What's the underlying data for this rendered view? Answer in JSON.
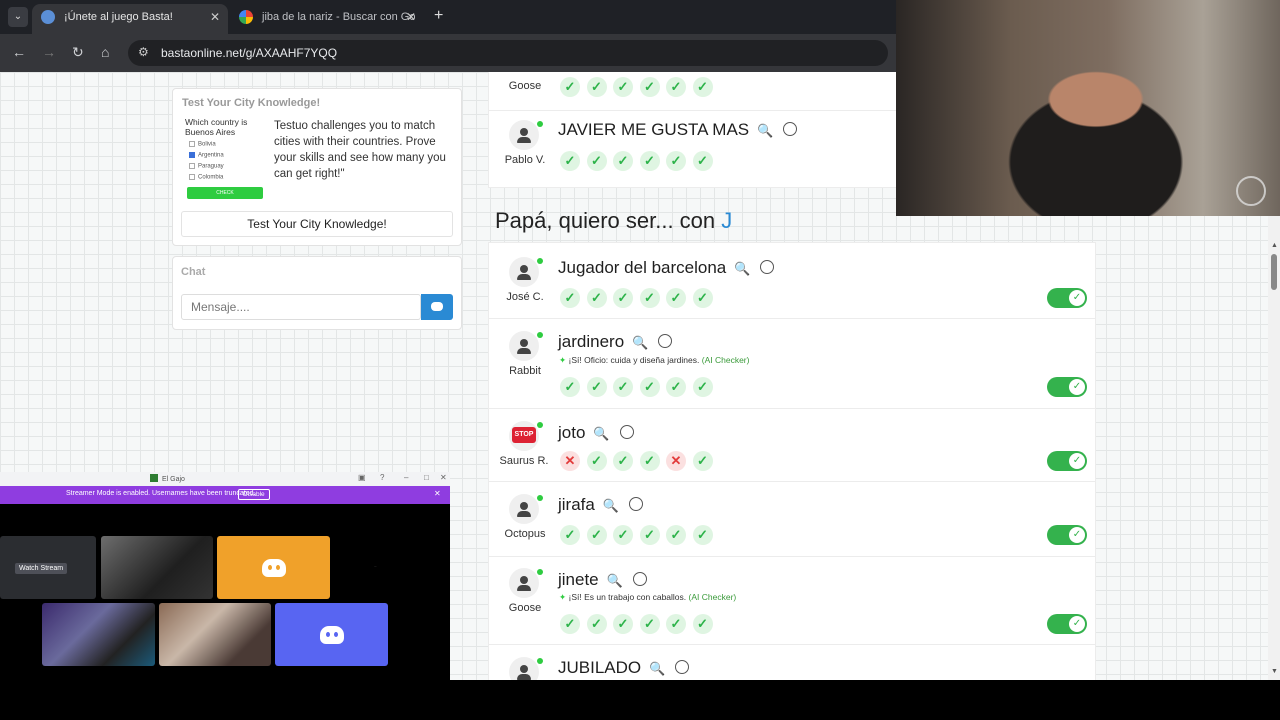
{
  "browser": {
    "tabs": [
      {
        "title": "¡Únete al juego Basta!",
        "close": "✕"
      },
      {
        "title": "jiba de la nariz - Buscar con Go",
        "close": "✕"
      }
    ],
    "new_tab": "+",
    "tab_menu": "⌄",
    "url": "bastaonline.net/g/AXAAHF7YQQ",
    "nav": {
      "back": "←",
      "forward": "→",
      "reload": "↻",
      "home": "⌂",
      "site_info": "⚙"
    }
  },
  "promo": {
    "title": "Test Your City Knowledge!",
    "quiz_question": "Which country is Buenos Aires",
    "quiz_options": [
      "Bolivia",
      "Argentina",
      "Paraguay",
      "Colombia"
    ],
    "quiz_selected": "Argentina",
    "quiz_button": "CHECK",
    "blurb": "Testuo challenges you to match cities with their countries. Prove your skills and see how many you can get right!\"",
    "button": "Test Your City Knowledge!"
  },
  "chat": {
    "title": "Chat",
    "placeholder": "Mensaje...."
  },
  "previous_category": {
    "partial_row": {
      "user": "Goose",
      "votes": [
        "ok",
        "ok",
        "ok",
        "ok",
        "ok",
        "ok"
      ]
    },
    "row": {
      "user": "Pablo V.",
      "word": "JAVIER ME GUSTA MAS",
      "votes": [
        "ok",
        "ok",
        "ok",
        "ok",
        "ok",
        "ok"
      ]
    }
  },
  "category": {
    "prefix": "Papá, quiero ser... con",
    "letter": "J"
  },
  "answers": [
    {
      "user": "José C.",
      "word": "Jugador del barcelona",
      "ai_note": null,
      "votes": [
        "ok",
        "ok",
        "ok",
        "ok",
        "ok",
        "ok"
      ],
      "accepted": true
    },
    {
      "user": "Rabbit",
      "word": "jardinero",
      "ai_note": {
        "text": "¡Sí! Oficio: cuida y diseña jardines.",
        "tag": "(AI Checker)"
      },
      "votes": [
        "ok",
        "ok",
        "ok",
        "ok",
        "ok",
        "ok"
      ],
      "accepted": true
    },
    {
      "user": "Saurus R.",
      "word": "joto",
      "ai_note": null,
      "votes": [
        "no",
        "ok",
        "ok",
        "ok",
        "no",
        "ok"
      ],
      "accepted": true,
      "avatar_text": "STOP"
    },
    {
      "user": "Octopus",
      "word": "jirafa",
      "ai_note": null,
      "votes": [
        "ok",
        "ok",
        "ok",
        "ok",
        "ok",
        "ok"
      ],
      "accepted": true
    },
    {
      "user": "Goose",
      "word": "jinete",
      "ai_note": {
        "text": "¡Sí! Es un trabajo con caballos.",
        "tag": "(AI Checker)"
      },
      "votes": [
        "ok",
        "ok",
        "ok",
        "ok",
        "ok",
        "ok"
      ],
      "accepted": true
    },
    {
      "user": "",
      "word": "JUBILADO",
      "ai_note": null,
      "votes": [],
      "accepted": null
    }
  ],
  "icons": {
    "search": "🔍",
    "ok": "✓",
    "no": "✕"
  },
  "discord": {
    "window_title": "El Gajo",
    "banner": "Streamer Mode is enabled. Usernames have been truncated.",
    "disable": "Disable",
    "watch_stream": "Watch Stream",
    "tiny_text": "..."
  },
  "colors": {
    "accent_blue": "#2a8ad4",
    "ok_green": "#2db34a",
    "error_red": "#e23b3b",
    "toggle_green": "#34b24d",
    "discord_purple": "#5865f2",
    "banner_purple": "#8f3de0"
  }
}
